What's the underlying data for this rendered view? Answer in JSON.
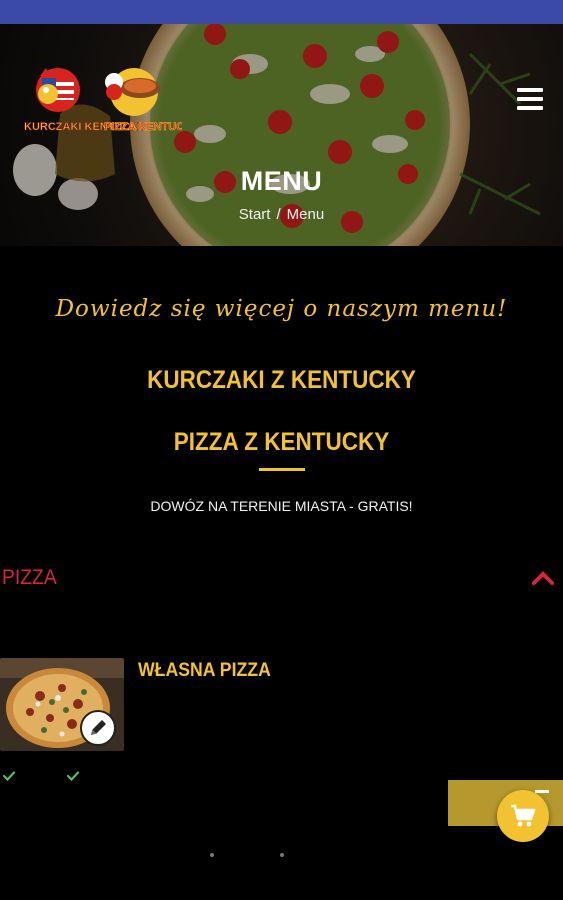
{
  "hero": {
    "title": "MENU",
    "breadcrumb": {
      "start": "Start",
      "separator": "/",
      "current": "Menu"
    },
    "logo": {
      "left_text": "KURCZAKI KENTUCKY",
      "right_text": "PIZZA KENTUCKY"
    }
  },
  "intro": {
    "tagline": "Dowiedz się więcej o naszym menu!",
    "brand_line_1": "KURCZAKI Z KENTUCKY",
    "brand_line_2": "PIZZA Z KENTUCKY",
    "delivery_note": "DOWÓZ NA TERENIE MIASTA - GRATIS!"
  },
  "category": {
    "name": "PIZZA",
    "expanded": true
  },
  "products": [
    {
      "name": "WŁASNA PIZZA"
    }
  ],
  "icons": {
    "menu": "hamburger-menu-icon",
    "collapse": "chevron-up-icon",
    "edit": "pencil-icon",
    "check": "check-icon",
    "cart": "shopping-cart-icon"
  },
  "colors": {
    "accent": "#f2c230",
    "category": "#d7263d",
    "status_bar": "#3b4aa6",
    "background": "#000000",
    "side_tab": "#b5992f",
    "check": "#5cb85c"
  }
}
